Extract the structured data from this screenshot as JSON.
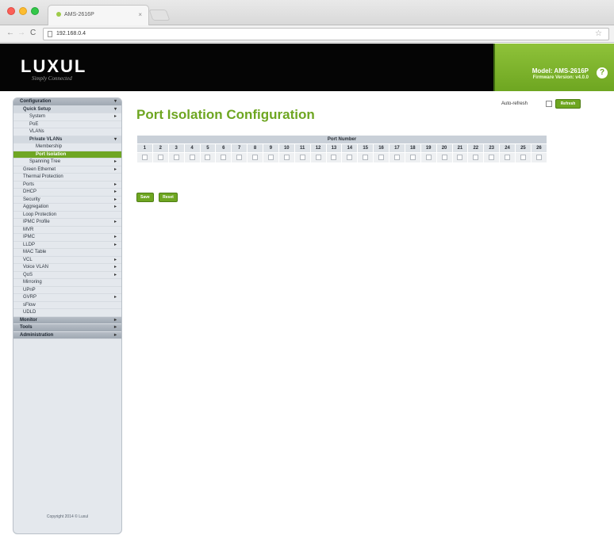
{
  "browser": {
    "tab_title": "AMS-2616P",
    "tab_close": "×",
    "url": "192.168.0.4",
    "back": "←",
    "forward": "→",
    "reload": "C",
    "star": "☆"
  },
  "header": {
    "logo": "LUXUL",
    "tagline": "Simply Connected",
    "model": "Model: AMS-2616P",
    "firmware": "Firmware Version: v4.0.0",
    "help": "?"
  },
  "sidebar": {
    "items": [
      {
        "label": "Configuration",
        "arrow": "▾"
      },
      {
        "label": "Quick Setup",
        "arrow": "▾"
      },
      {
        "label": "System",
        "arrow": "▸"
      },
      {
        "label": "PoE",
        "arrow": ""
      },
      {
        "label": "VLANs",
        "arrow": ""
      },
      {
        "label": "Private VLANs",
        "arrow": "▾"
      },
      {
        "label": "Membership",
        "arrow": ""
      },
      {
        "label": "Port Isolation",
        "arrow": ""
      },
      {
        "label": "Spanning Tree",
        "arrow": "▸"
      },
      {
        "label": "Green Ethernet",
        "arrow": "▸"
      },
      {
        "label": "Thermal Protection",
        "arrow": ""
      },
      {
        "label": "Ports",
        "arrow": "▸"
      },
      {
        "label": "DHCP",
        "arrow": "▸"
      },
      {
        "label": "Security",
        "arrow": "▸"
      },
      {
        "label": "Aggregation",
        "arrow": "▸"
      },
      {
        "label": "Loop Protection",
        "arrow": ""
      },
      {
        "label": "IPMC Profile",
        "arrow": "▸"
      },
      {
        "label": "MVR",
        "arrow": ""
      },
      {
        "label": "IPMC",
        "arrow": "▸"
      },
      {
        "label": "LLDP",
        "arrow": "▸"
      },
      {
        "label": "MAC Table",
        "arrow": ""
      },
      {
        "label": "VCL",
        "arrow": "▸"
      },
      {
        "label": "Voice VLAN",
        "arrow": "▸"
      },
      {
        "label": "QoS",
        "arrow": "▸"
      },
      {
        "label": "Mirroring",
        "arrow": ""
      },
      {
        "label": "UPnP",
        "arrow": ""
      },
      {
        "label": "GVRP",
        "arrow": "▸"
      },
      {
        "label": "sFlow",
        "arrow": ""
      },
      {
        "label": "UDLD",
        "arrow": ""
      },
      {
        "label": "Monitor",
        "arrow": "▸"
      },
      {
        "label": "Tools",
        "arrow": "▸"
      },
      {
        "label": "Administration",
        "arrow": "▸"
      }
    ],
    "copyright": "Copyright 2014 © Luxul"
  },
  "main": {
    "title": "Port Isolation Configuration",
    "auto_refresh_label": "Auto-refresh",
    "refresh_button": "Refresh",
    "table_header": "Port Number",
    "ports": [
      "1",
      "2",
      "3",
      "4",
      "5",
      "6",
      "7",
      "8",
      "9",
      "10",
      "11",
      "12",
      "13",
      "14",
      "15",
      "16",
      "17",
      "18",
      "19",
      "20",
      "21",
      "22",
      "23",
      "24",
      "25",
      "26"
    ],
    "save_button": "Save",
    "reset_button": "Reset"
  }
}
